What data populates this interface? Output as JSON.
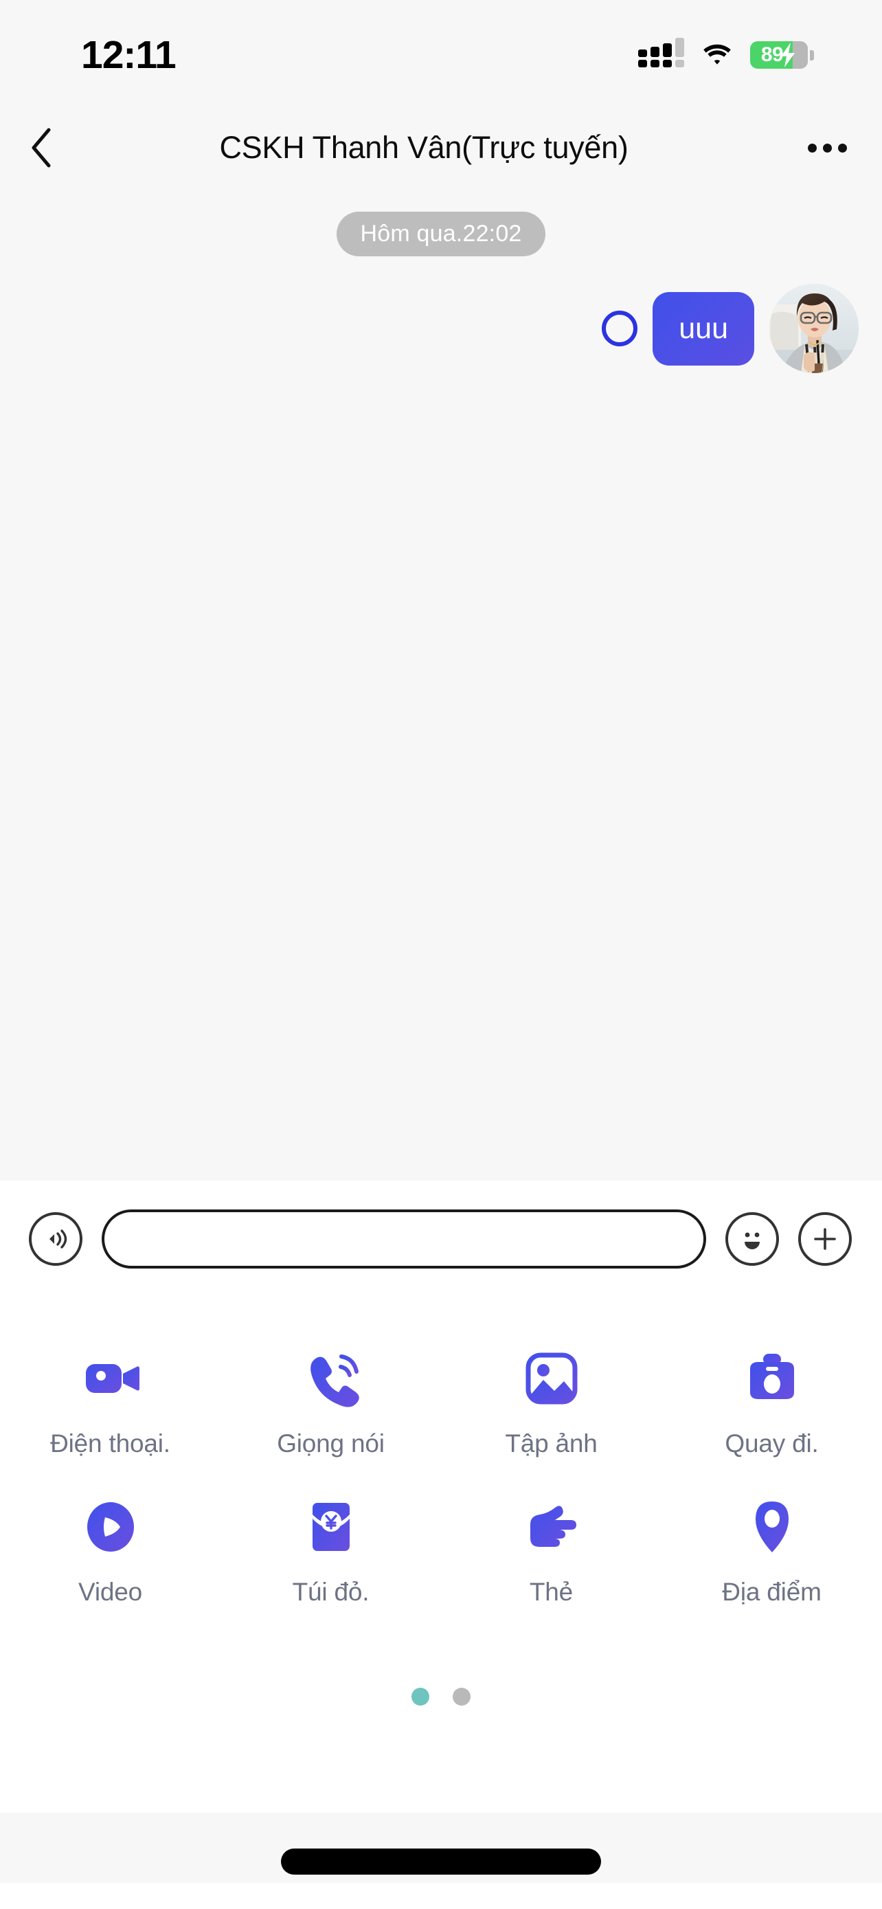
{
  "status_bar": {
    "time": "12:11",
    "battery_percent": "89",
    "icons": [
      "cellular-signal-icon",
      "wifi-icon",
      "battery-charging-icon"
    ]
  },
  "header": {
    "back_icon": "chevron-left-icon",
    "title": "CSKH Thanh Vân(Trực tuyến)",
    "more_icon": "more-horizontal-icon"
  },
  "chat": {
    "timestamp": "Hôm qua.22:02",
    "messages": [
      {
        "text": "uuu",
        "side": "outgoing",
        "status_icon": "pending-ring-icon",
        "avatar": "user-avatar",
        "bubble_color": "#4050ea"
      }
    ]
  },
  "input_bar": {
    "voice_icon": "voice-wave-icon",
    "input_value": "",
    "input_placeholder": "",
    "emoji_icon": "smiley-face-icon",
    "plus_icon": "plus-circle-icon"
  },
  "actions": {
    "rows": [
      [
        {
          "label": "Điện thoại.",
          "icon": "video-camera-icon"
        },
        {
          "label": "Giọng nói",
          "icon": "phone-call-icon"
        },
        {
          "label": "Tập ảnh",
          "icon": "photo-gallery-icon"
        },
        {
          "label": "Quay đi.",
          "icon": "camera-icon"
        }
      ],
      [
        {
          "label": "Video",
          "icon": "play-circle-icon"
        },
        {
          "label": "Túi đỏ.",
          "icon": "red-envelope-icon"
        },
        {
          "label": "Thẻ",
          "icon": "pointing-hand-icon"
        },
        {
          "label": "Địa điểm",
          "icon": "map-pin-icon"
        }
      ]
    ]
  },
  "pagination": {
    "pages": 2,
    "active_index": 0,
    "active_color": "#6fc4c0",
    "inactive_color": "#b9b9b9"
  },
  "theme": {
    "accent": "#4050ea",
    "chat_bg": "#f7f7f7",
    "label_color": "#6d7384"
  }
}
